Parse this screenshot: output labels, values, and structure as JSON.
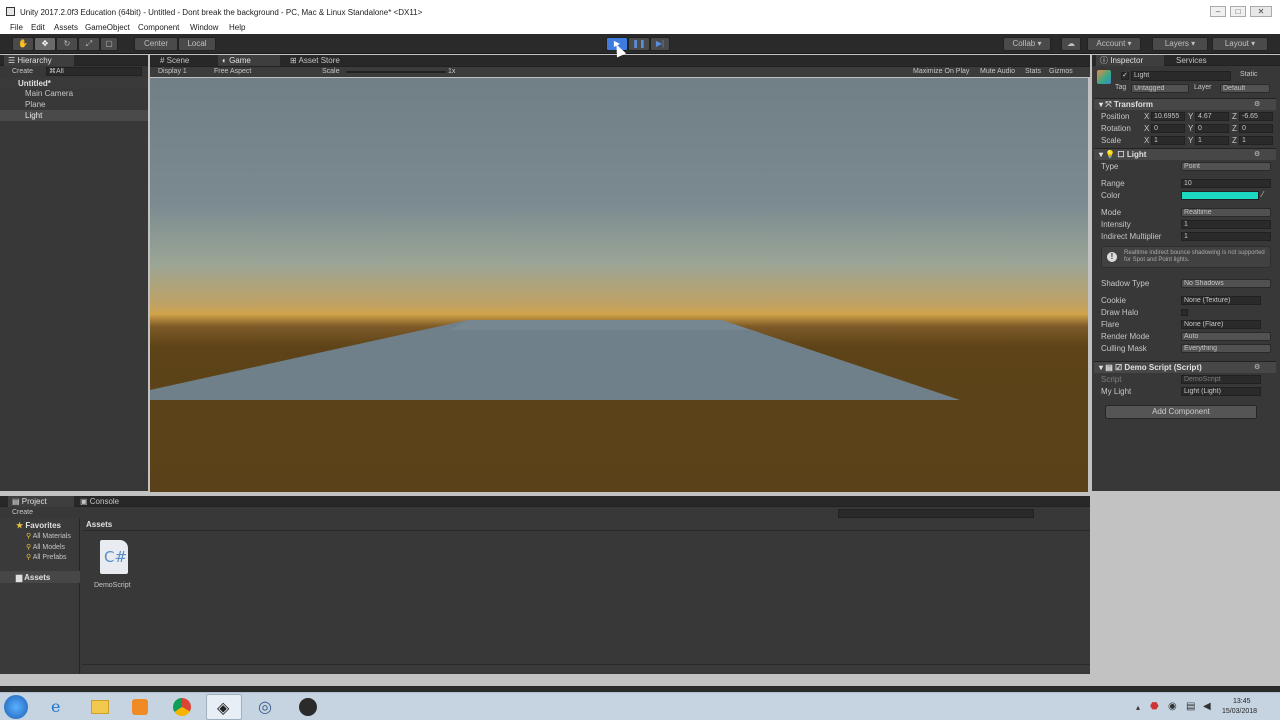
{
  "window": {
    "title": "Unity 2017.2.0f3 Education (64bit) - Untitled - Dont break the background - PC, Mac & Linux Standalone* <DX11>"
  },
  "menu": [
    "File",
    "Edit",
    "Assets",
    "GameObject",
    "Component",
    "Window",
    "Help"
  ],
  "toolbar": {
    "center": "Center",
    "local": "Local",
    "collab": "Collab",
    "account": "Account",
    "layers": "Layers",
    "layout": "Layout"
  },
  "hierarchy": {
    "tab": "Hierarchy",
    "create": "Create",
    "search": "⌘All",
    "scene": "Untitled*",
    "items": [
      "Main Camera",
      "Plane",
      "Light"
    ]
  },
  "center_tabs": {
    "scene": "Scene",
    "game": "Game",
    "store": "Asset Store"
  },
  "game": {
    "display": "Display 1",
    "aspect": "Free Aspect",
    "scale_label": "Scale",
    "scale_value": "1x",
    "maximize": "Maximize On Play",
    "mute": "Mute Audio",
    "stats": "Stats",
    "gizmos": "Gizmos"
  },
  "inspector": {
    "tab": "Inspector",
    "services": "Services",
    "object_name": "Light",
    "static": "Static",
    "tag_label": "Tag",
    "tag": "Untagged",
    "layer_label": "Layer",
    "layer": "Default",
    "transform": {
      "title": "Transform",
      "position": "Position",
      "rotation": "Rotation",
      "scale": "Scale",
      "pos": [
        "X",
        "10.6955",
        "Y",
        "4.67",
        "Z",
        "-6.65"
      ],
      "rot": [
        "X",
        "0",
        "Y",
        "0",
        "Z",
        "0"
      ],
      "scl": [
        "X",
        "1",
        "Y",
        "1",
        "Z",
        "1"
      ]
    },
    "light": {
      "title": "Light",
      "type_label": "Type",
      "type": "Point",
      "range_label": "Range",
      "range": "10",
      "color_label": "Color",
      "color": "#1bd9c0",
      "mode_label": "Mode",
      "mode": "Realtime",
      "intensity_label": "Intensity",
      "intensity": "1",
      "indirect_label": "Indirect Multiplier",
      "indirect": "1",
      "warning": "Realtime indirect bounce shadowing is not supported for Spot and Point lights.",
      "shadow_label": "Shadow Type",
      "shadow": "No Shadows",
      "cookie_label": "Cookie",
      "cookie": "None (Texture)",
      "halo_label": "Draw Halo",
      "flare_label": "Flare",
      "flare": "None (Flare)",
      "render_label": "Render Mode",
      "render": "Auto",
      "culling_label": "Culling Mask",
      "culling": "Everything"
    },
    "script": {
      "title": "Demo Script (Script)",
      "script_label": "Script",
      "script": "DemoScript",
      "mylight_label": "My Light",
      "mylight": "Light (Light)"
    },
    "add_component": "Add Component"
  },
  "project": {
    "tab": "Project",
    "console": "Console",
    "create": "Create",
    "favorites": "Favorites",
    "fav_items": [
      "All Materials",
      "All Models",
      "All Prefabs"
    ],
    "assets_tree": "Assets",
    "breadcrumb": "Assets",
    "file": "DemoScript"
  },
  "clock": {
    "time": "13:45",
    "date": "15/03/2018"
  },
  "colors": {
    "light_color": "#1bd9c0",
    "accent": "#3e7ce0"
  }
}
